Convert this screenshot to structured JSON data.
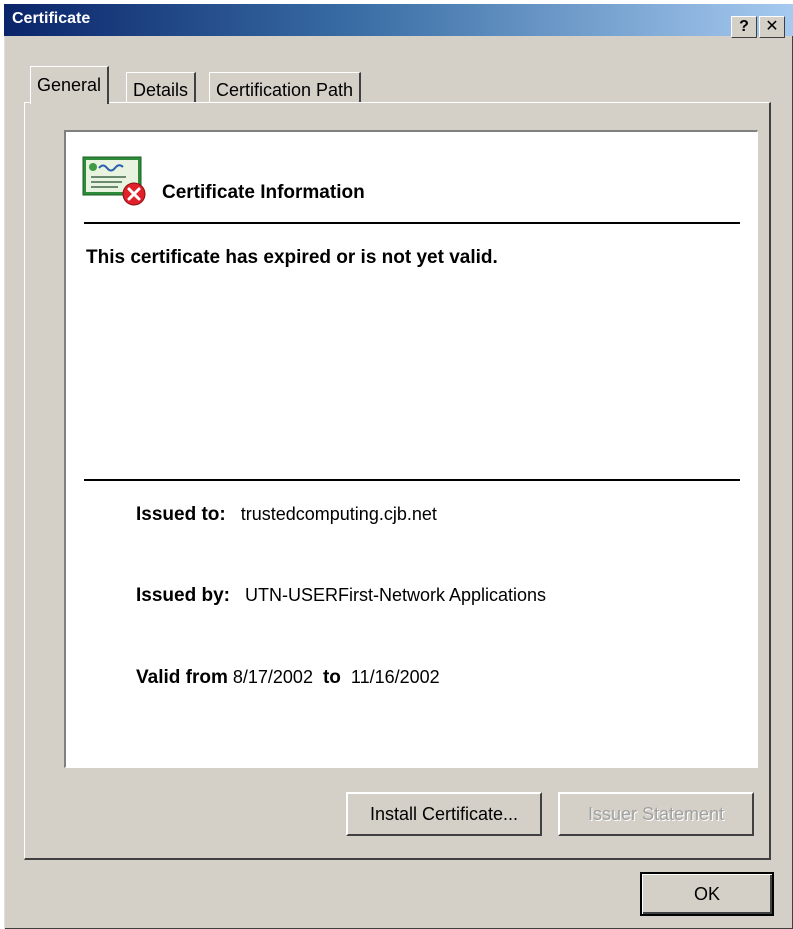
{
  "window": {
    "title": "Certificate",
    "help_label": "?",
    "close_label": "✕",
    "help_icon": "help-icon",
    "close_icon": "close-icon"
  },
  "tabs": [
    {
      "label": "General",
      "active": true
    },
    {
      "label": "Details",
      "active": false
    },
    {
      "label": "Certification Path",
      "active": false
    }
  ],
  "general": {
    "header": "Certificate Information",
    "warning": "This certificate has expired or is not yet valid.",
    "issued_to_label": "Issued to:",
    "issued_to_value": "trustedcomputing.cjb.net",
    "issued_by_label": "Issued by:",
    "issued_by_value": "UTN-USERFirst-Network Applications",
    "valid_from_label": "Valid from",
    "valid_from_value": "8/17/2002",
    "valid_to_label": "to",
    "valid_to_value": "11/16/2002",
    "icon": "certificate-error-icon"
  },
  "buttons": {
    "install": "Install Certificate...",
    "issuer_statement": "Issuer Statement",
    "ok": "OK"
  },
  "colors": {
    "titlebar_start": "#0a246a",
    "titlebar_end": "#a6caf0",
    "face": "#d4d0c8",
    "error_red": "#e0212b"
  }
}
